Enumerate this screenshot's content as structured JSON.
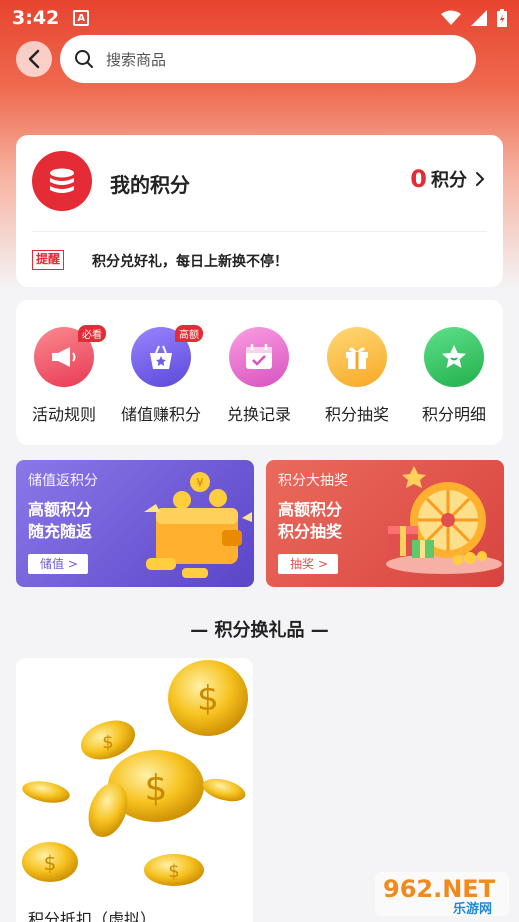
{
  "status_bar": {
    "time": "3:42",
    "app_badge": "A"
  },
  "topbar": {
    "search_placeholder": "搜索商品"
  },
  "points_card": {
    "title": "我的积分",
    "value": "0",
    "unit": "积分",
    "remind_tag": "提醒",
    "remind_text": "积分兑好礼，每日上新换不停！"
  },
  "menu": {
    "items": [
      {
        "label": "活动规则",
        "badge": "必看",
        "icon": "megaphone-icon",
        "color": "#f04b62"
      },
      {
        "label": "储值赚积分",
        "badge": "高额",
        "icon": "shopping-bag-star-icon",
        "color": "#6e5de6"
      },
      {
        "label": "兑换记录",
        "badge": "",
        "icon": "calendar-check-icon",
        "color": "#e76fd0"
      },
      {
        "label": "积分抽奖",
        "badge": "",
        "icon": "gift-icon",
        "color": "#ffc24a"
      },
      {
        "label": "积分明细",
        "badge": "",
        "icon": "star-icon",
        "color": "#31c35b"
      }
    ]
  },
  "promos": [
    {
      "title": "储值返积分",
      "line1": "高额积分",
      "line2": "随充随返",
      "button": "储值 >",
      "color": "#6b5ad6"
    },
    {
      "title": "积分大抽奖",
      "line1": "高额积分",
      "line2": "积分抽奖",
      "button": "抽奖 >",
      "color": "#e24f4f"
    }
  ],
  "section": {
    "title": "— 积分换礼品 —"
  },
  "gifts": [
    {
      "name": "积分抵扣（虚拟）"
    }
  ],
  "watermark": {
    "brand": "962.NET",
    "site": "乐游网"
  }
}
